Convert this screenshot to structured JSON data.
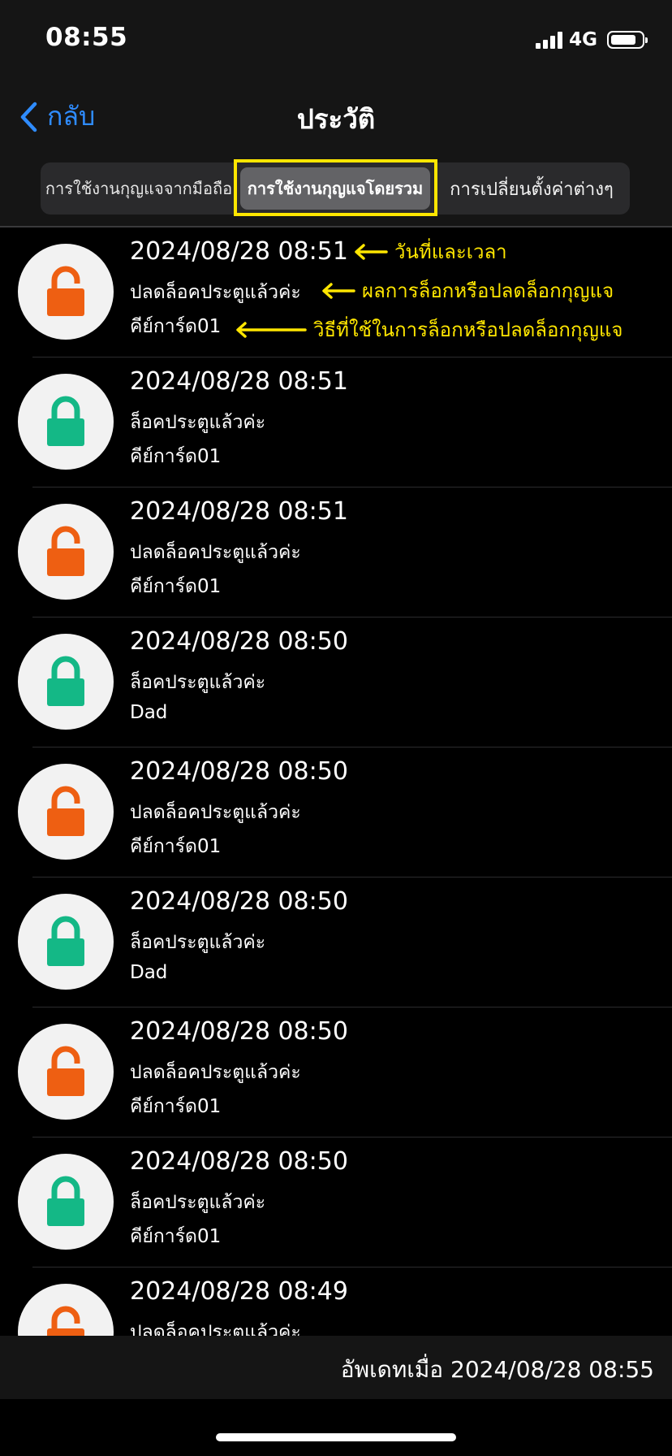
{
  "status_bar": {
    "time": "08:55",
    "network": "4G"
  },
  "nav": {
    "back_label": "กลับ",
    "title": "ประวัติ"
  },
  "tabs": [
    {
      "label": "การใช้งานกุญแจจากมือถือ",
      "selected": false
    },
    {
      "label": "การใช้งานกุญแจโดยรวม",
      "selected": true
    },
    {
      "label": "การเปลี่ยนตั้งค่าต่างๆ",
      "selected": false
    }
  ],
  "annotations": {
    "datetime": "วันที่และเวลา",
    "result": "ผลการล็อกหรือปลดล็อกกุญแจ",
    "method": "วิธีที่ใช้ในการล็อกหรือปลดล็อกกุญแจ"
  },
  "history": [
    {
      "datetime": "2024/08/28 08:51",
      "status": "ปลดล็อคประตูแล้วค่ะ",
      "method": "คีย์การ์ด01",
      "locked": false
    },
    {
      "datetime": "2024/08/28 08:51",
      "status": "ล็อคประตูแล้วค่ะ",
      "method": "คีย์การ์ด01",
      "locked": true
    },
    {
      "datetime": "2024/08/28 08:51",
      "status": "ปลดล็อคประตูแล้วค่ะ",
      "method": "คีย์การ์ด01",
      "locked": false
    },
    {
      "datetime": "2024/08/28 08:50",
      "status": "ล็อคประตูแล้วค่ะ",
      "method": "Dad",
      "locked": true
    },
    {
      "datetime": "2024/08/28 08:50",
      "status": "ปลดล็อคประตูแล้วค่ะ",
      "method": "คีย์การ์ด01",
      "locked": false
    },
    {
      "datetime": "2024/08/28 08:50",
      "status": "ล็อคประตูแล้วค่ะ",
      "method": "Dad",
      "locked": true
    },
    {
      "datetime": "2024/08/28 08:50",
      "status": "ปลดล็อคประตูแล้วค่ะ",
      "method": "คีย์การ์ด01",
      "locked": false
    },
    {
      "datetime": "2024/08/28 08:50",
      "status": "ล็อคประตูแล้วค่ะ",
      "method": "คีย์การ์ด01",
      "locked": true
    },
    {
      "datetime": "2024/08/28 08:49",
      "status": "ปลดล็อคประตูแล้วค่ะ",
      "method": "",
      "locked": false
    }
  ],
  "footer": {
    "updated_text": "อัพเดทเมื่อ 2024/08/28 08:55"
  },
  "colors": {
    "locked": "#14b886",
    "unlocked": "#ee5f12",
    "accent": "#2f8cff",
    "annotation": "#ffe600"
  }
}
